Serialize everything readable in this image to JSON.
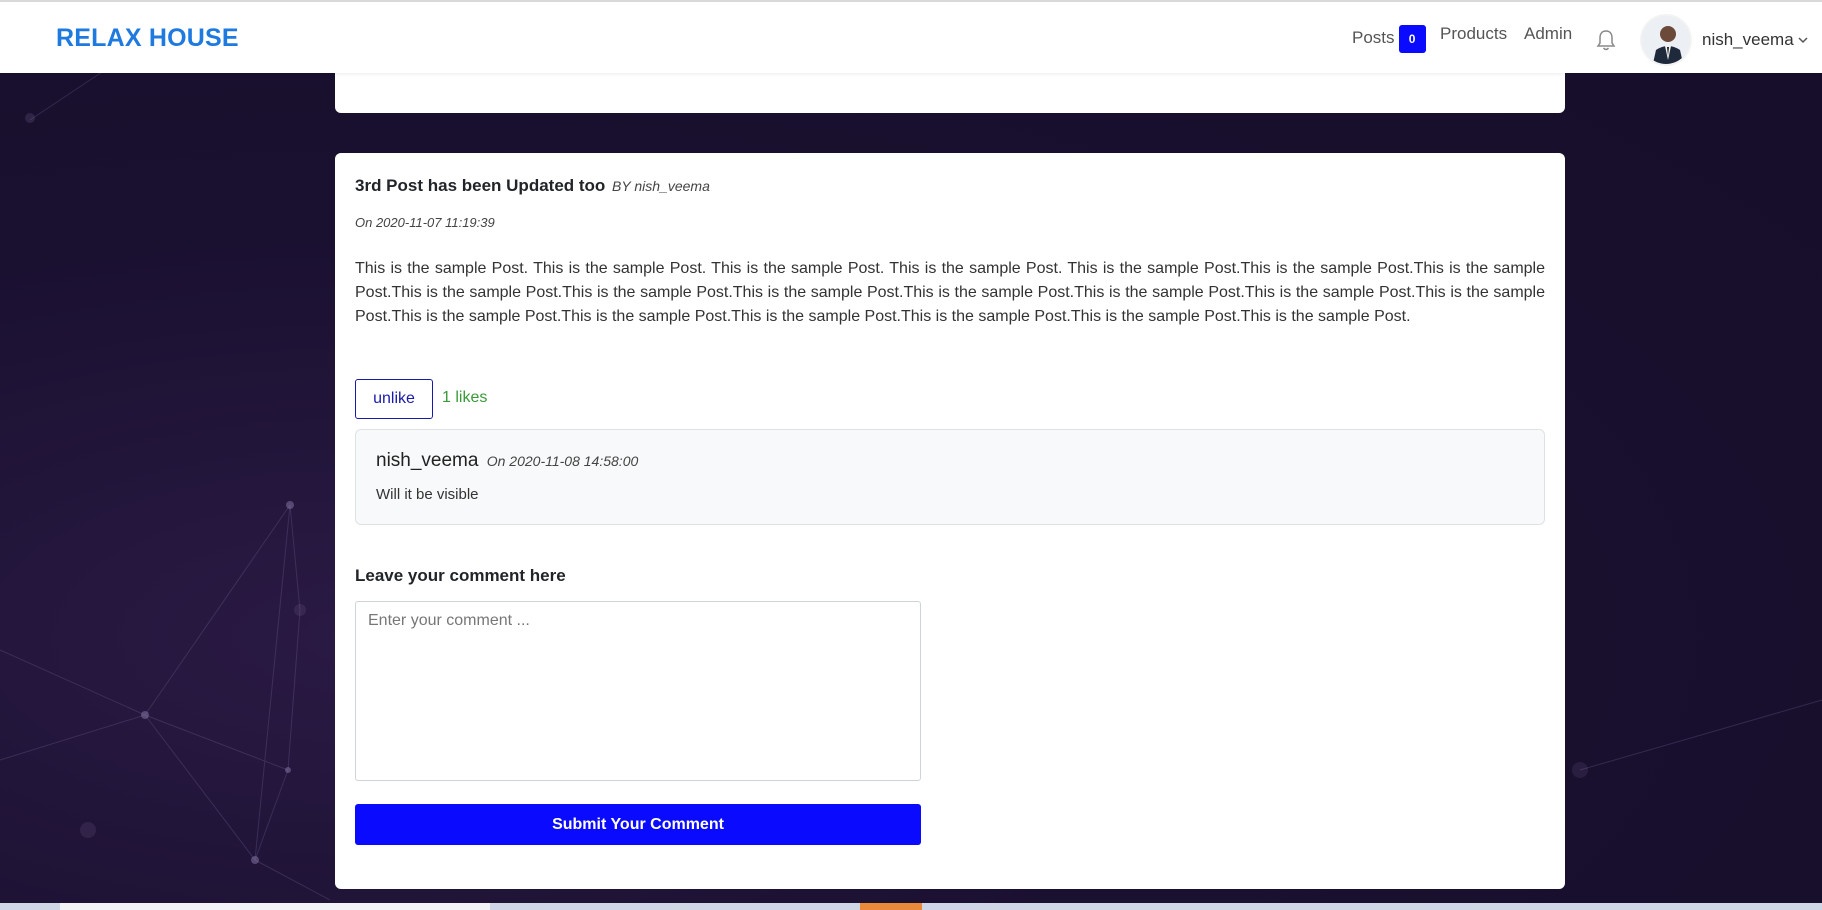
{
  "header": {
    "brand": "RELAX HOUSE",
    "nav": {
      "posts_label": "Posts",
      "posts_count": "0",
      "products_label": "Products",
      "admin_label": "Admin"
    },
    "user": {
      "name": "nish_veema"
    },
    "icons": {
      "notifications": "bell-icon",
      "dropdown": "chevron-down-icon",
      "avatar": "user-avatar"
    }
  },
  "post": {
    "title": "3rd Post has been Updated too",
    "by": "BY nish_veema",
    "date": "On 2020-11-07 11:19:39",
    "body": "This is the sample Post. This is the sample Post. This is the sample Post. This is the sample Post. This is the sample Post.This is the sample Post.This is the sample Post.This is the sample Post.This is the sample Post.This is the sample Post.This is the sample Post.This is the sample Post.This is the sample Post.This is the sample Post.This is the sample Post.This is the sample Post.This is the sample Post.This is the sample Post.This is the sample Post.This is the sample Post.",
    "unlike_label": "unlike",
    "likes": "1 likes"
  },
  "comments": [
    {
      "author": "nish_veema",
      "date": "On 2020-11-08 14:58:00",
      "text": "Will it be visible"
    }
  ],
  "comment_form": {
    "heading": "Leave your comment here",
    "placeholder": "Enter your comment ...",
    "value": "",
    "submit_label": "Submit Your Comment"
  },
  "colors": {
    "brand": "#1f7ae0",
    "primary_button": "#0a0aff",
    "likes_text": "#3a9a3a",
    "background": "#1a1030"
  }
}
